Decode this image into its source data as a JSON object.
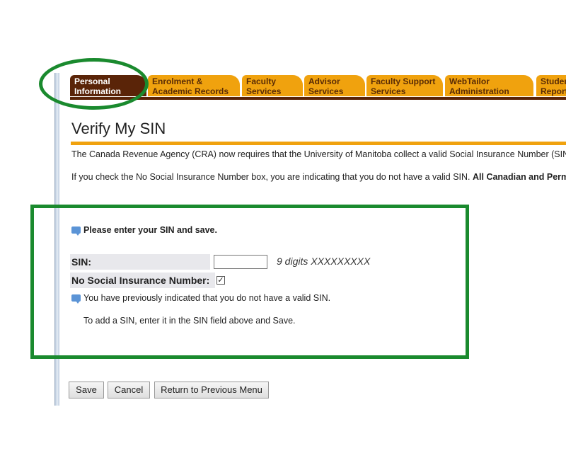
{
  "tabs": [
    {
      "line1": "Personal",
      "line2": "Information",
      "active": true
    },
    {
      "line1": "Enrolment &",
      "line2": "Academic Records",
      "active": false
    },
    {
      "line1": "Faculty",
      "line2": "Services",
      "active": false
    },
    {
      "line1": "Advisor",
      "line2": "Services",
      "active": false
    },
    {
      "line1": "Faculty Support",
      "line2": "Services",
      "active": false
    },
    {
      "line1": "WebTailor",
      "line2": "Administration",
      "active": false
    },
    {
      "line1": "Student",
      "line2": "Reports",
      "active": false
    }
  ],
  "page": {
    "title": "Verify My SIN",
    "para1": "The Canada Revenue Agency (CRA) now requires that the University of Manitoba collect a valid Social Insurance Number (SIN)",
    "para2_plain": "If you check the No Social Insurance Number box, you are indicating that you do not have a valid SIN. ",
    "para2_bold": "All Canadian and Permanent Residents"
  },
  "form": {
    "instruction": "Please enter your SIN and save.",
    "sin_label": "SIN:",
    "sin_value": "",
    "sin_hint": "9 digits XXXXXXXXX",
    "no_sin_label": "No Social Insurance Number:",
    "no_sin_checked": true,
    "notice": "You have previously indicated that you do not have a valid SIN.",
    "notice2": "To add a SIN, enter it in the SIN field above and Save."
  },
  "buttons": {
    "save": "Save",
    "cancel": "Cancel",
    "return": "Return to Previous Menu"
  },
  "colors": {
    "tab_orange": "#f0a20e",
    "tab_active": "#5a2408",
    "highlight_green": "#1a8a2e"
  }
}
